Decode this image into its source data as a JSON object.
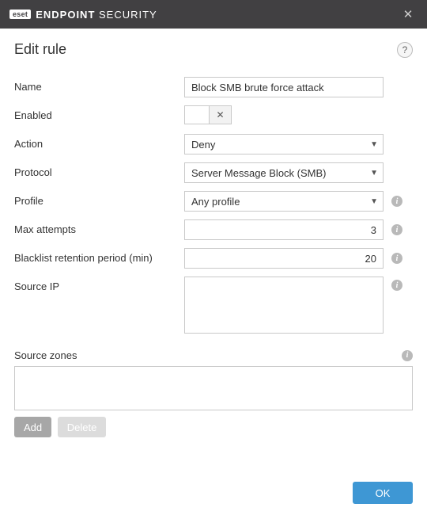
{
  "brand": {
    "badge": "eset",
    "bold": "ENDPOINT",
    "light": " SECURITY"
  },
  "header": {
    "title": "Edit rule"
  },
  "labels": {
    "name": "Name",
    "enabled": "Enabled",
    "action": "Action",
    "protocol": "Protocol",
    "profile": "Profile",
    "max_attempts": "Max attempts",
    "blacklist_retention": "Blacklist retention period (min)",
    "source_ip": "Source IP",
    "source_zones": "Source zones"
  },
  "values": {
    "name": "Block SMB brute force attack",
    "action": "Deny",
    "protocol": "Server Message Block (SMB)",
    "profile": "Any profile",
    "max_attempts": "3",
    "blacklist_retention": "20",
    "source_ip": ""
  },
  "buttons": {
    "add": "Add",
    "delete": "Delete",
    "ok": "OK"
  },
  "icons": {
    "close": "✕",
    "help": "?",
    "info": "i",
    "toggle_off": "✕",
    "chevron": "▼"
  }
}
